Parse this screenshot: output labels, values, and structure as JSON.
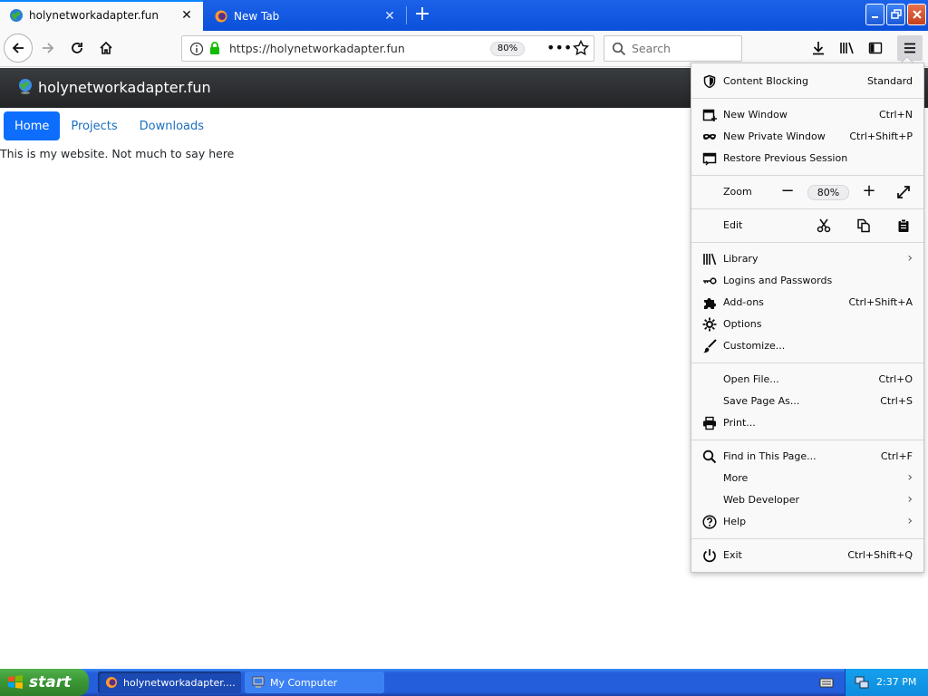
{
  "browser": {
    "tabs": [
      {
        "label": "holynetworkadapter.fun",
        "active": true
      },
      {
        "label": "New Tab",
        "active": false
      }
    ],
    "url": "https://holynetworkadapter.fun",
    "zoom_badge": "80%",
    "search_placeholder": "Search"
  },
  "page": {
    "site_title": "holynetworkadapter.fun",
    "nav": [
      "Home",
      "Projects",
      "Downloads"
    ],
    "active_nav": "Home",
    "body_text": "This is my website. Not much to say here"
  },
  "app_menu": {
    "content_blocking": {
      "label": "Content Blocking",
      "value": "Standard"
    },
    "new_window": {
      "label": "New Window",
      "shortcut": "Ctrl+N"
    },
    "new_private_window": {
      "label": "New Private Window",
      "shortcut": "Ctrl+Shift+P"
    },
    "restore_session": {
      "label": "Restore Previous Session"
    },
    "zoom": {
      "label": "Zoom",
      "value": "80%",
      "minus": "−",
      "plus": "+"
    },
    "edit": {
      "label": "Edit"
    },
    "library": {
      "label": "Library"
    },
    "logins": {
      "label": "Logins and Passwords"
    },
    "addons": {
      "label": "Add-ons",
      "shortcut": "Ctrl+Shift+A"
    },
    "options": {
      "label": "Options"
    },
    "customize": {
      "label": "Customize..."
    },
    "open_file": {
      "label": "Open File...",
      "shortcut": "Ctrl+O"
    },
    "save_page": {
      "label": "Save Page As...",
      "shortcut": "Ctrl+S"
    },
    "print": {
      "label": "Print..."
    },
    "find": {
      "label": "Find in This Page...",
      "shortcut": "Ctrl+F"
    },
    "more": {
      "label": "More"
    },
    "web_developer": {
      "label": "Web Developer"
    },
    "help": {
      "label": "Help"
    },
    "exit": {
      "label": "Exit",
      "shortcut": "Ctrl+Shift+Q"
    }
  },
  "taskbar": {
    "start_label": "start",
    "tasks": [
      {
        "label": "holynetworkadapter....",
        "active": true
      },
      {
        "label": "My Computer",
        "active": false
      }
    ],
    "clock": "2:37 PM"
  },
  "colors": {
    "xp_blue": "#245edb",
    "firefox_accent": "#0a84ff",
    "site_link": "#1b6ec2",
    "site_active": "#0d6efd",
    "lock_green": "#12bc00"
  }
}
